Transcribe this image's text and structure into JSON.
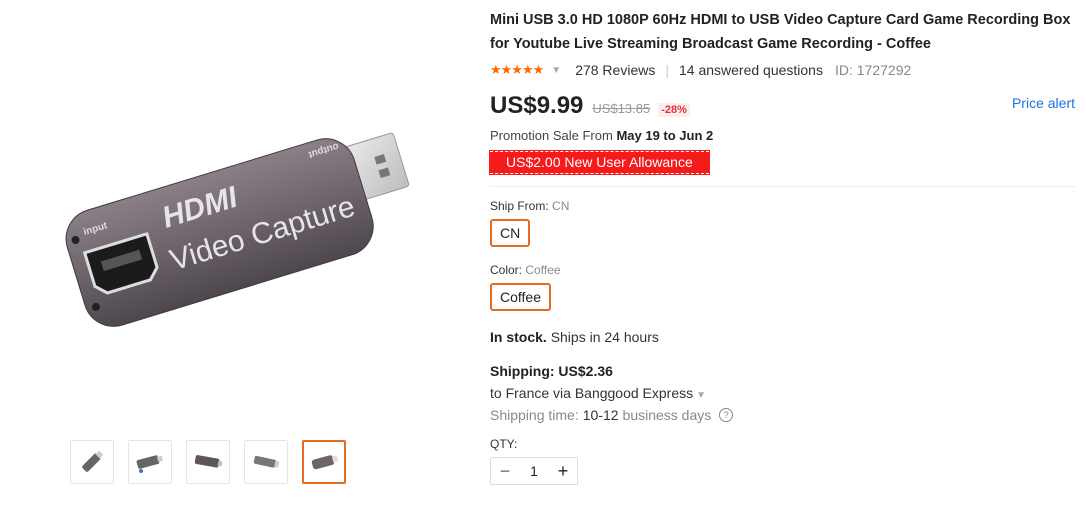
{
  "product": {
    "title_line1": "Mini USB 3.0 HD 1080P 60Hz HDMI to USB Video Capture Card Game Recording Box",
    "title_line2": "for Youtube Live Streaming Broadcast Game Recording - Coffee",
    "stars": "★★★★★",
    "reviews": "278 Reviews",
    "questions": "14 answered questions",
    "id_text": "ID: 1727292"
  },
  "image": {
    "label_hdmi": "HDMI",
    "label_video_capture": "Video Capture",
    "label_input": "input",
    "label_output": "output"
  },
  "thumbnails": [
    {
      "name": "thumb-1",
      "active": false
    },
    {
      "name": "thumb-2",
      "active": false
    },
    {
      "name": "thumb-3",
      "active": false
    },
    {
      "name": "thumb-4",
      "active": false
    },
    {
      "name": "thumb-5",
      "active": true
    }
  ],
  "pricing": {
    "price": "US$9.99",
    "old_price": "US$13.85",
    "discount": "-28%",
    "price_alert": "Price alert",
    "promo_prefix": "Promotion Sale From",
    "promo_dates": "May 19 to Jun 2",
    "allowance": "US$2.00 New User Allowance"
  },
  "options": {
    "ship_from_label": "Ship From:",
    "ship_from_value": "CN",
    "ship_from_button": "CN",
    "color_label": "Color:",
    "color_value": "Coffee",
    "color_button": "Coffee"
  },
  "stock": {
    "status": "In stock.",
    "detail": "Ships in 24 hours"
  },
  "shipping": {
    "title": "Shipping: US$2.36",
    "to": "to France via Banggood Express",
    "time_label": "Shipping time:",
    "time_value": "10-12",
    "time_unit": "business days"
  },
  "quantity": {
    "label": "QTY:",
    "value": "1",
    "minus": "−",
    "plus": "+"
  },
  "colors": {
    "accent": "#e86a1f",
    "star": "#ff6a00",
    "allowance_bg": "#f51b1b",
    "link": "#1a73e8"
  }
}
